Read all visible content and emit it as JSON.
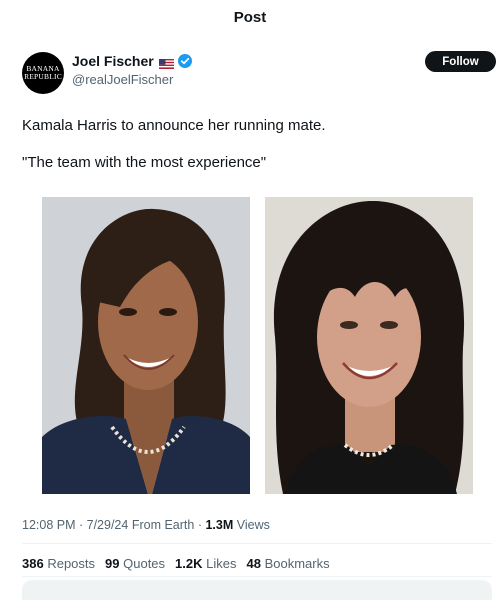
{
  "header": {
    "title": "Post"
  },
  "author": {
    "avatar_text_line1": "BANANA",
    "avatar_text_line2": "REPUBLIC",
    "display_name": "Joel Fischer",
    "handle": "@realJoelFischer",
    "flag_icon": "us-flag-icon",
    "verified_icon": "verified-badge-icon",
    "follow_label": "Follow",
    "more_label": "···"
  },
  "post": {
    "paragraphs": [
      "Kamala Harris to announce her running mate.",
      "\"The team with the most experience\""
    ]
  },
  "meta": {
    "time": "12:08 PM",
    "sep1": " · ",
    "date": "7/29/24",
    "source": " From Earth",
    "sep2": " · ",
    "views_count": "1.3M",
    "views_label": " Views"
  },
  "stats": {
    "reposts_count": "386",
    "reposts_label": "Reposts",
    "quotes_count": "99",
    "quotes_label": "Quotes",
    "likes_count": "1.2K",
    "likes_label": "Likes",
    "bookmarks_count": "48",
    "bookmarks_label": "Bookmarks"
  },
  "colors": {
    "text": "#0f1419",
    "secondary": "#536471",
    "verified": "#1d9bf0",
    "follow_bg": "#0f1419"
  }
}
